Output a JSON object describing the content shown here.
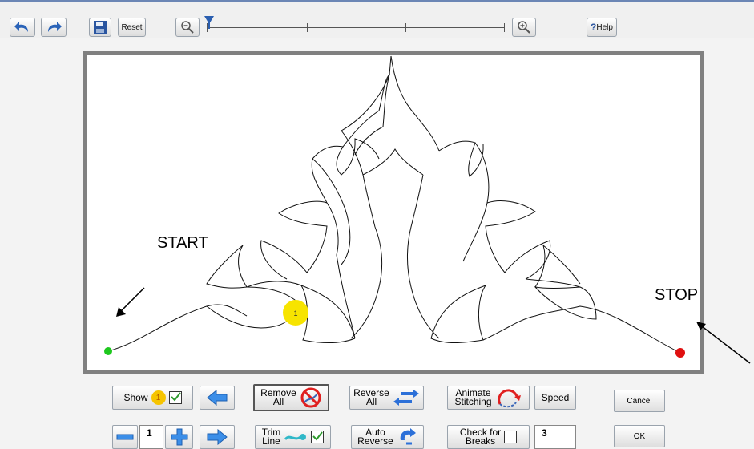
{
  "toolbar": {
    "undo_icon": "undo-arrow-icon",
    "redo_icon": "redo-arrow-icon",
    "save_icon": "floppy-disk-icon",
    "reset_label": "Reset",
    "zoom_out_icon": "magnifier-minus-icon",
    "zoom_in_icon": "magnifier-plus-icon",
    "help_label": "Help",
    "help_mark": "?"
  },
  "canvas": {
    "start_label": "START",
    "stop_label": "STOP",
    "marker_number": "1",
    "start_color": "#1ec81e",
    "stop_color": "#e01010",
    "marker_color": "#f7e400"
  },
  "controls": {
    "show_label": "Show",
    "show_badge": "1",
    "remove_all_line1": "Remove",
    "remove_all_line2": "All",
    "reverse_all_line1": "Reverse",
    "reverse_all_line2": "All",
    "animate_line1": "Animate",
    "animate_line2": "Stitching",
    "speed_label": "Speed",
    "cancel_label": "Cancel",
    "marker_value": "1",
    "trim_line1": "Trim",
    "trim_line2": "Line",
    "auto_reverse_line1": "Auto",
    "auto_reverse_line2": "Reverse",
    "check_breaks_line1": "Check for",
    "check_breaks_line2": "Breaks",
    "breaks_value": "3",
    "ok_label": "OK"
  }
}
